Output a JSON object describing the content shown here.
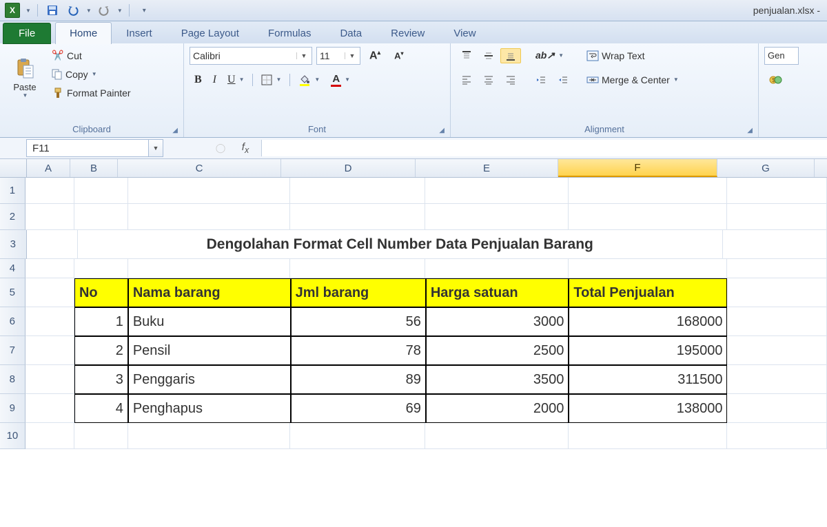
{
  "app": {
    "title": "penjualan.xlsx -"
  },
  "tabs": [
    "File",
    "Home",
    "Insert",
    "Page Layout",
    "Formulas",
    "Data",
    "Review",
    "View"
  ],
  "ribbon": {
    "clipboard": {
      "paste": "Paste",
      "cut": "Cut",
      "copy": "Copy",
      "fmtpainter": "Format Painter",
      "label": "Clipboard"
    },
    "font": {
      "name": "Calibri",
      "size": "11",
      "label": "Font"
    },
    "alignment": {
      "wrap": "Wrap Text",
      "merge": "Merge & Center",
      "label": "Alignment"
    },
    "number": {
      "general": "Gen"
    }
  },
  "namebox": "F11",
  "columns": [
    "A",
    "B",
    "C",
    "D",
    "E",
    "F",
    "G"
  ],
  "rownums": [
    1,
    2,
    3,
    4,
    5,
    6,
    7,
    8,
    9,
    10
  ],
  "sheet": {
    "title": "Dengolahan Format Cell Number Data Penjualan Barang",
    "headers": [
      "No",
      "Nama barang",
      "Jml barang",
      "Harga satuan",
      "Total Penjualan"
    ],
    "rows": [
      {
        "no": 1,
        "nama": "Buku",
        "jml": 56,
        "harga": 3000,
        "total": 168000
      },
      {
        "no": 2,
        "nama": "Pensil",
        "jml": 78,
        "harga": 2500,
        "total": 195000
      },
      {
        "no": 3,
        "nama": "Penggaris",
        "jml": 89,
        "harga": 3500,
        "total": 311500
      },
      {
        "no": 4,
        "nama": "Penghapus",
        "jml": 69,
        "harga": 2000,
        "total": 138000
      }
    ]
  },
  "chart_data": {
    "type": "table",
    "title": "Dengolahan Format Cell Number Data Penjualan Barang",
    "columns": [
      "No",
      "Nama barang",
      "Jml barang",
      "Harga satuan",
      "Total Penjualan"
    ],
    "rows": [
      [
        1,
        "Buku",
        56,
        3000,
        168000
      ],
      [
        2,
        "Pensil",
        78,
        2500,
        195000
      ],
      [
        3,
        "Penggaris",
        89,
        3500,
        311500
      ],
      [
        4,
        "Penghapus",
        69,
        2000,
        138000
      ]
    ]
  }
}
